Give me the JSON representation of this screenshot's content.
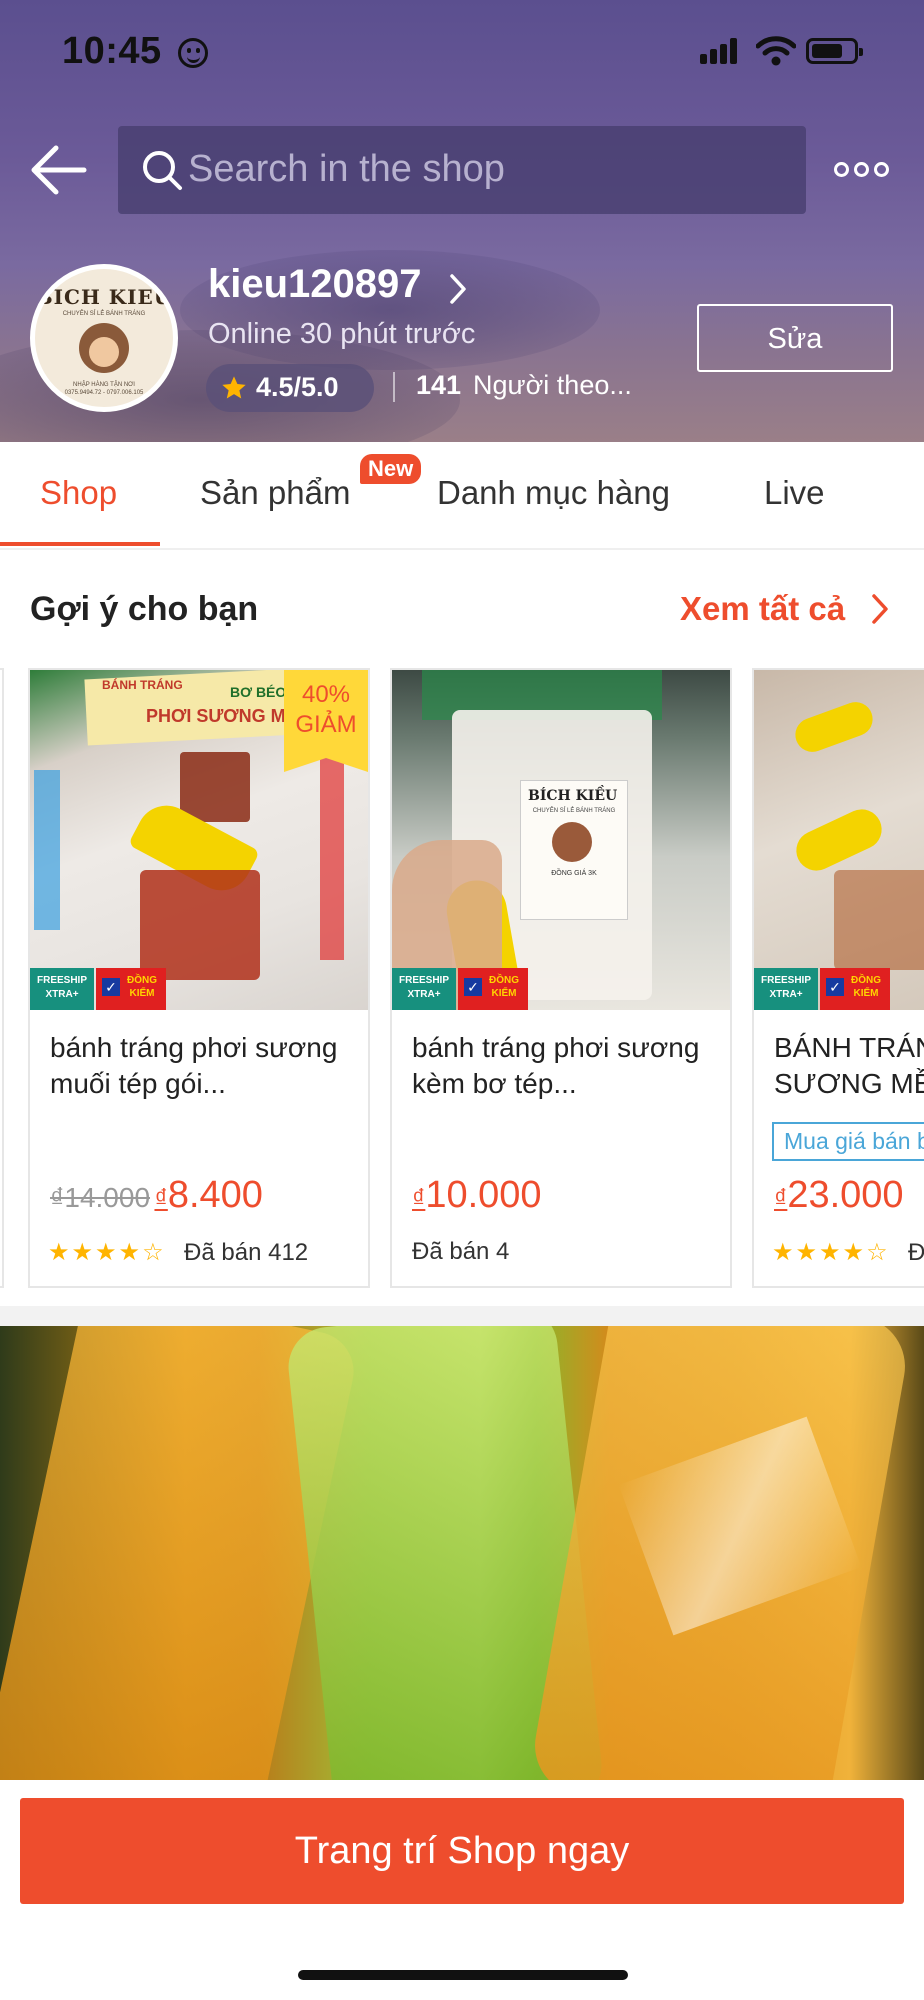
{
  "status_bar": {
    "time": "10:45"
  },
  "header": {
    "search_placeholder": "Search in the shop",
    "shop": {
      "name": "kieu120897",
      "online_status": "Online 30 phút trước",
      "rating": "4.5/5.0",
      "followers_count": "141",
      "followers_label": "Người theo...",
      "edit_label": "Sửa",
      "avatar": {
        "brand": "BICH KIEU",
        "subtitle": "CHUYÊN SỈ LẺ BÁNH TRÁNG",
        "footer_line1": "NHẬP HÀNG TẬN NƠI",
        "footer_line2": "0375.9494.72 - 0797.006.105"
      }
    }
  },
  "tabs": [
    {
      "label": "Shop",
      "active": true
    },
    {
      "label": "Sản phẩm",
      "badge": "New"
    },
    {
      "label": "Danh mục hàng"
    },
    {
      "label": "Live"
    }
  ],
  "section": {
    "title": "Gợi ý cho bạn",
    "see_all": "Xem tất cả"
  },
  "badges": {
    "freeship": [
      "FREESHIP",
      "XTRA+"
    ],
    "checked": [
      "ĐỒNG",
      "KIỂM"
    ]
  },
  "products": [
    {
      "title": "bánh tráng phơi sương muối tép gói...",
      "old_price": "₫14.000",
      "price_currency": "₫",
      "price": "8.400",
      "stars": 4,
      "sold": "Đã bán 412",
      "discount": [
        "40%",
        "GIẢM"
      ],
      "image_text": [
        "BÁNH TRÁNG",
        "BƠ BÉO",
        "PHƠI SƯƠNG MUỐI"
      ]
    },
    {
      "title": "bánh tráng phơi sương kèm bơ tép...",
      "price_currency": "₫",
      "price": "10.000",
      "sold": "Đã bán 4",
      "image_text": [
        "BÍCH KIỀU",
        "CHUYÊN SỈ LẺ BÁNH TRÁNG",
        "ĐỒNG GIÁ 3K"
      ]
    },
    {
      "title": "BÁNH TRÁNG PHƠI SƯƠNG MỀM",
      "promo": "Mua giá bán buôn",
      "price_currency": "₫",
      "price": "23.000",
      "stars": 4,
      "sold": "Đã bán"
    }
  ],
  "cta": {
    "label": "Trang trí Shop ngay"
  },
  "colors": {
    "accent": "#ee4d2d",
    "header_top": "#5b4f8f",
    "star": "#ffb400",
    "promo_blue": "#4aa6d8"
  },
  "icons": [
    "face-icon",
    "signal-icon",
    "wifi-icon",
    "battery-icon",
    "back-arrow-icon",
    "search-icon",
    "more-icon",
    "chevron-right-icon",
    "star-icon"
  ]
}
